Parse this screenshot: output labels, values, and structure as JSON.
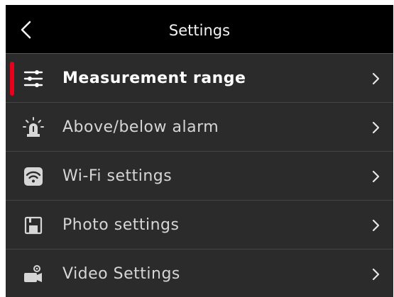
{
  "header": {
    "title": "Settings",
    "back_icon": "chevron-left-icon"
  },
  "colors": {
    "background": "#2b2b2b",
    "header": "#000000",
    "accent": "#e8001c",
    "text": "#d6d6d6",
    "active_text": "#ffffff"
  },
  "menu": {
    "items": [
      {
        "label": "Measurement range",
        "icon": "sliders-icon",
        "selected": true
      },
      {
        "label": "Above/below alarm",
        "icon": "alarm-light-icon",
        "selected": false
      },
      {
        "label": "Wi-Fi settings",
        "icon": "wifi-icon",
        "selected": false
      },
      {
        "label": "Photo settings",
        "icon": "save-icon",
        "selected": false
      },
      {
        "label": "Video Settings",
        "icon": "video-camera-icon",
        "selected": false
      }
    ]
  }
}
